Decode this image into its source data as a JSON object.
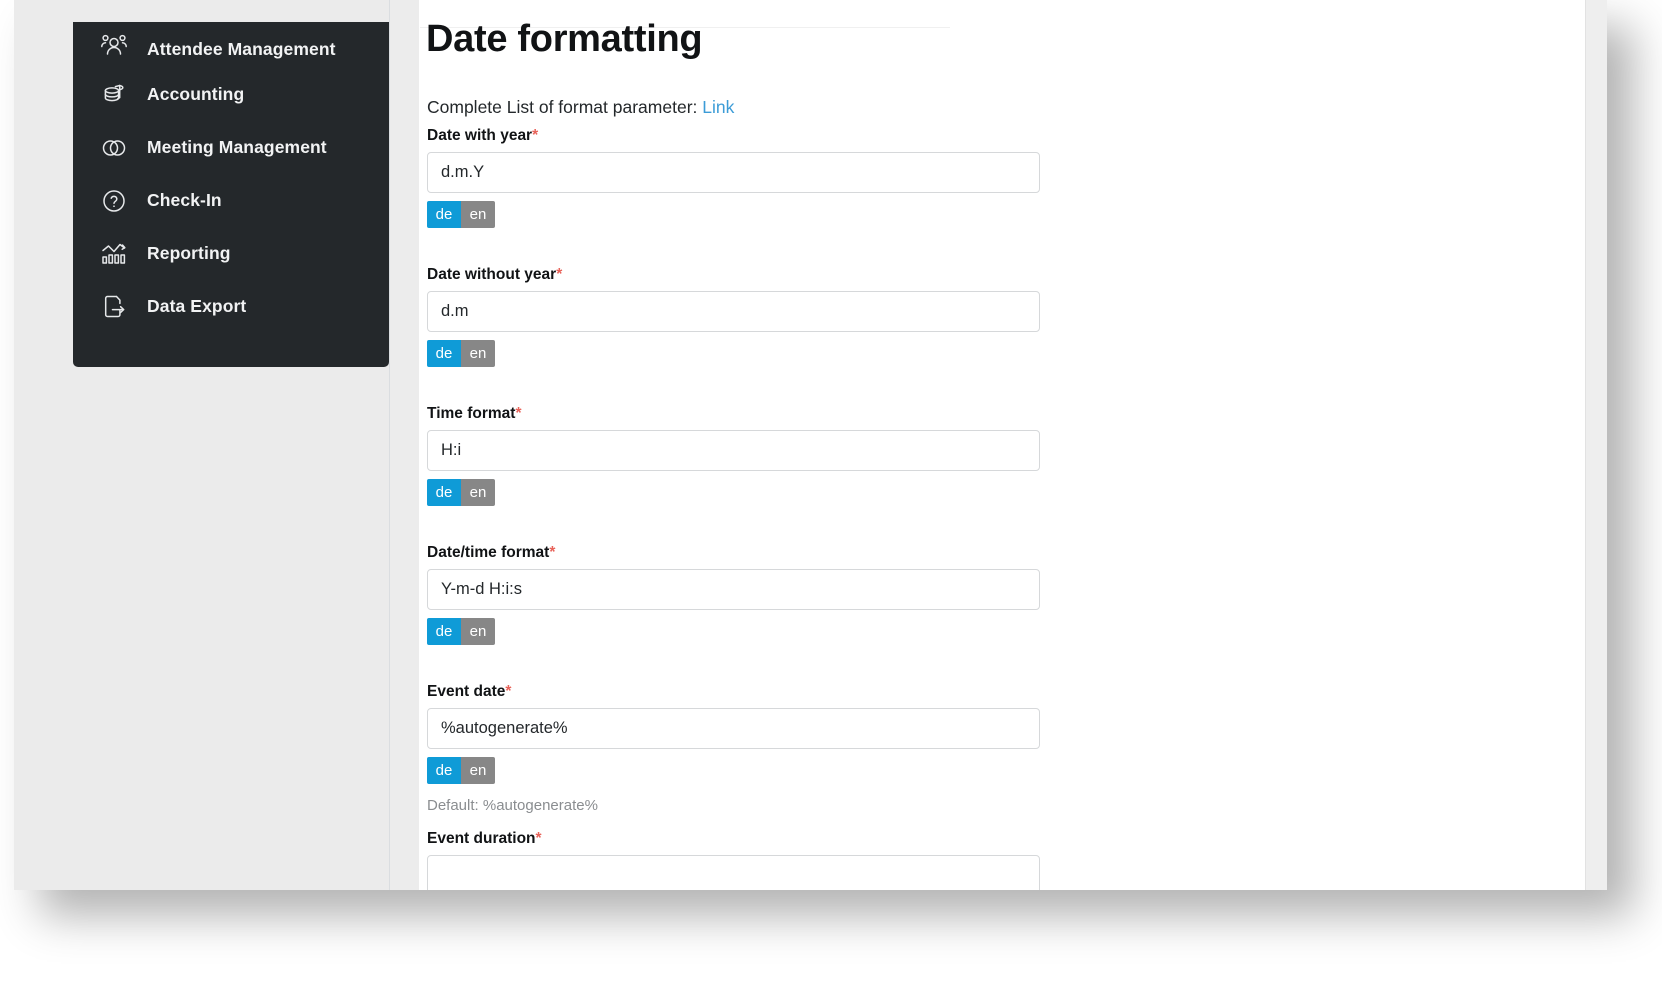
{
  "sidebar": {
    "items": [
      {
        "label": "Attendee Management",
        "icon": "users-group-icon"
      },
      {
        "label": "Accounting",
        "icon": "database-stack-icon"
      },
      {
        "label": "Meeting Management",
        "icon": "overlapping-circles-icon"
      },
      {
        "label": "Check-In",
        "icon": "question-circle-icon"
      },
      {
        "label": "Reporting",
        "icon": "bar-chart-line-icon"
      },
      {
        "label": "Data Export",
        "icon": "file-export-arrow-icon"
      }
    ]
  },
  "main": {
    "title": "Date formatting",
    "note_text": "Complete List of format parameter:",
    "note_link": "Link",
    "required_marker": "*",
    "fields": [
      {
        "label": "Date with year",
        "value": "d.m.Y",
        "placeholder": "",
        "langs": [
          {
            "code": "de",
            "active": true
          },
          {
            "code": "en",
            "active": false
          }
        ]
      },
      {
        "label": "Date without year",
        "value": "d.m",
        "placeholder": "",
        "langs": [
          {
            "code": "de",
            "active": true
          },
          {
            "code": "en",
            "active": false
          }
        ]
      },
      {
        "label": "Time format",
        "value": "H:i",
        "placeholder": "",
        "langs": [
          {
            "code": "de",
            "active": true
          },
          {
            "code": "en",
            "active": false
          }
        ]
      },
      {
        "label": "Date/time format",
        "value": "Y-m-d H:i:s",
        "placeholder": "",
        "langs": [
          {
            "code": "de",
            "active": true
          },
          {
            "code": "en",
            "active": false
          }
        ]
      },
      {
        "label": "Event date",
        "value": "%autogenerate%",
        "placeholder": "",
        "help": "Default: %autogenerate%",
        "langs": [
          {
            "code": "de",
            "active": true
          },
          {
            "code": "en",
            "active": false
          }
        ]
      },
      {
        "label": "Event duration",
        "value": "",
        "placeholder": "",
        "langs": []
      }
    ]
  },
  "colors": {
    "sidebar_bg": "#24282b",
    "accent_blue": "#0f9bd7",
    "inactive_gray": "#878787",
    "link_blue": "#3c9cd7",
    "required_red": "#e8635a",
    "page_bg": "#ebebeb"
  }
}
